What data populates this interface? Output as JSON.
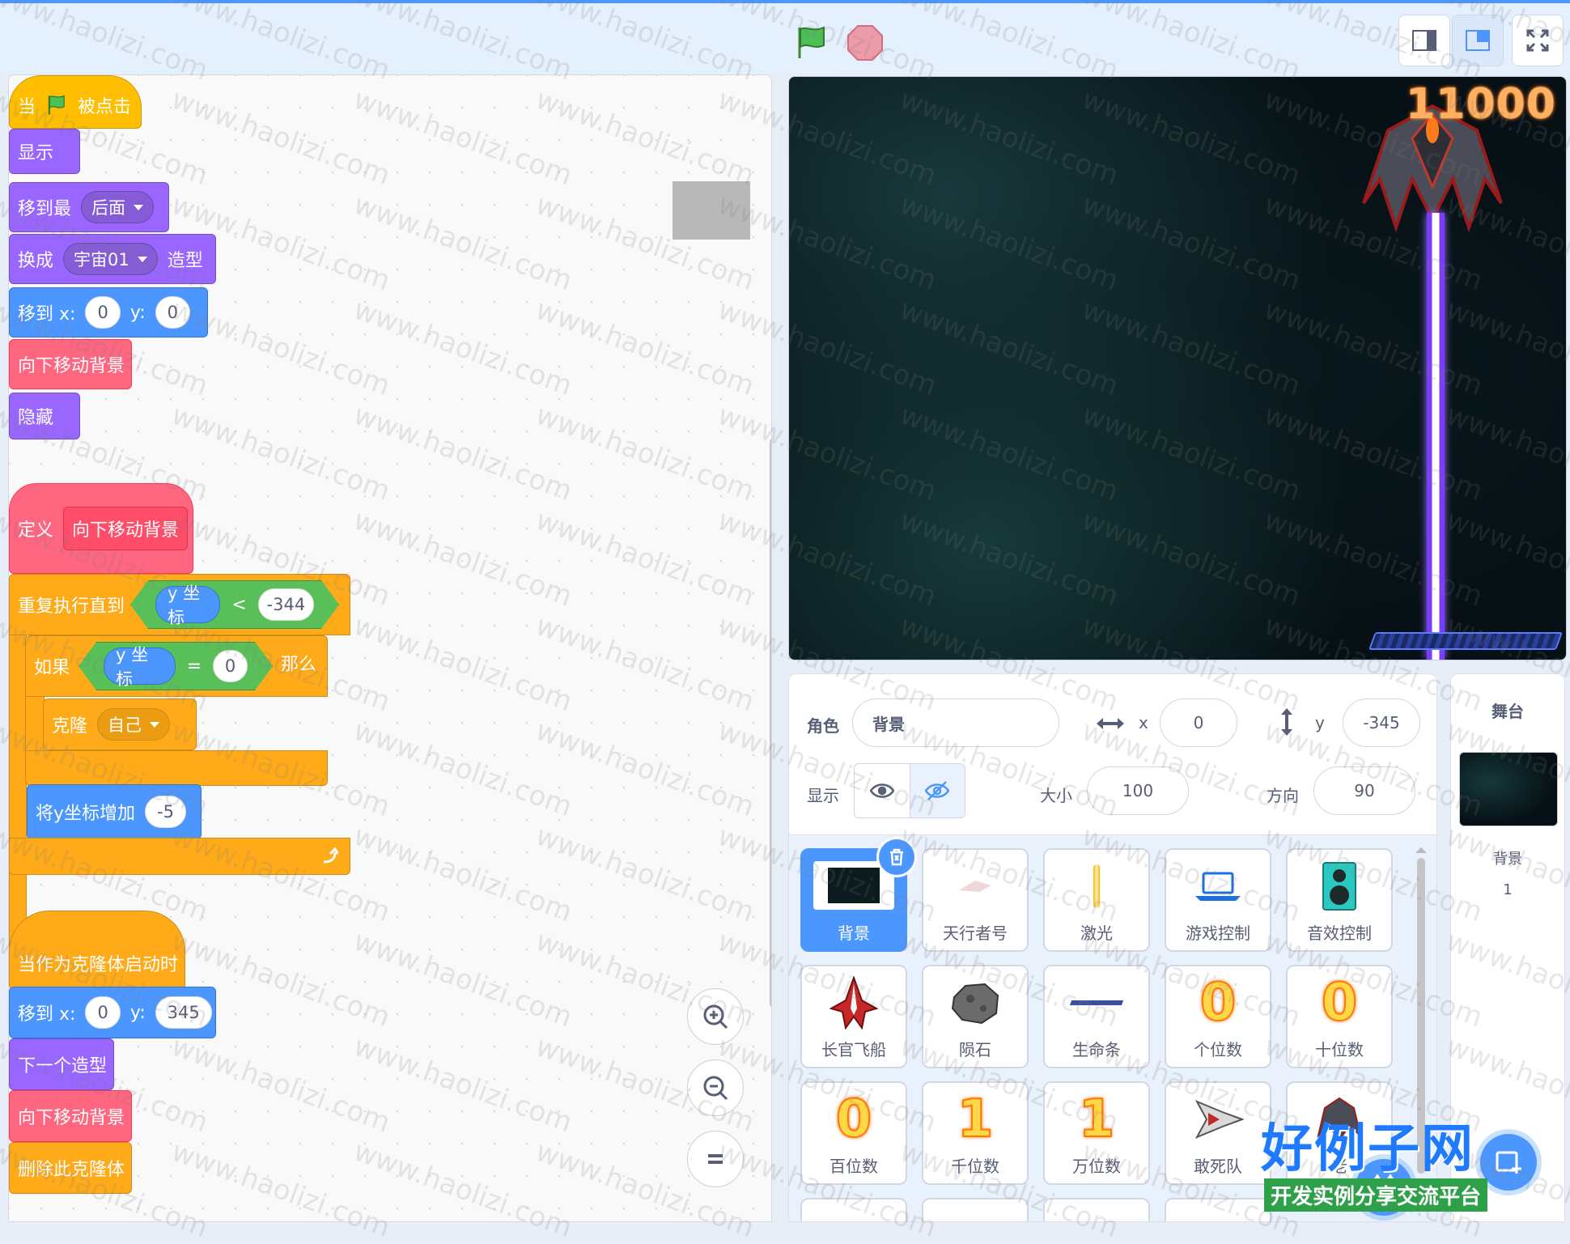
{
  "colors": {
    "accent": "#4c97ff",
    "events": "#ffbf00",
    "looks": "#9966ff",
    "motion": "#4c97ff",
    "myblocks": "#ff6680",
    "control": "#ffab19",
    "operators": "#59c059"
  },
  "toolbar": {
    "green_flag_icon": "green-flag-icon",
    "stop_icon": "stop-icon"
  },
  "scripts": {
    "s1": {
      "when": "当",
      "clicked": "被点击",
      "show": "显示",
      "goto_layer": "移到最",
      "goto_layer_opt": "后面",
      "switch_costume": "换成",
      "costume_opt": "宇宙01",
      "costume_suffix": "造型",
      "goto_xy": "移到 x:",
      "x": "0",
      "y_label": "y:",
      "y": "0",
      "call_move": "向下移动背景",
      "hide": "隐藏"
    },
    "s2": {
      "define": "定义",
      "proc_name": "向下移动背景",
      "repeat_until": "重复执行直到",
      "y_coord": "y 坐标",
      "lt": "<",
      "lt_val": "-344",
      "if": "如果",
      "y_coord2": "y 坐标",
      "eq": "=",
      "eq_val": "0",
      "then": "那么",
      "clone": "克隆",
      "clone_opt": "自己",
      "change_y": "将y坐标增加",
      "change_y_val": "-5"
    },
    "s3": {
      "clone_start": "当作为克隆体启动时",
      "goto_xy": "移到 x:",
      "x": "0",
      "y_label": "y:",
      "y": "345",
      "next_costume": "下一个造型",
      "call_move": "向下移动背景",
      "delete_clone": "删除此克隆体"
    }
  },
  "stage": {
    "score": "11000"
  },
  "sprite_info": {
    "sprite_label": "角色",
    "sprite_name": "背景",
    "x_label": "x",
    "x": "0",
    "y_label": "y",
    "y": "-345",
    "show_label": "显示",
    "size_label": "大小",
    "size": "100",
    "direction_label": "方向",
    "direction": "90"
  },
  "sprites": [
    {
      "name": "背景",
      "selected": true
    },
    {
      "name": "天行者号"
    },
    {
      "name": "激光"
    },
    {
      "name": "游戏控制"
    },
    {
      "name": "音效控制"
    },
    {
      "name": "长官飞船"
    },
    {
      "name": "陨石"
    },
    {
      "name": "生命条"
    },
    {
      "name": "个位数",
      "digit": "0"
    },
    {
      "name": "十位数",
      "digit": "0"
    },
    {
      "name": "百位数",
      "digit": "0"
    },
    {
      "name": "千位数",
      "digit": "1"
    },
    {
      "name": "万位数",
      "digit": "1"
    },
    {
      "name": "敢死队"
    },
    {
      "name": "老"
    }
  ],
  "stage_panel": {
    "title": "舞台",
    "bg_label": "背景",
    "bg_count": "1"
  },
  "watermark": {
    "logo": "好例子网",
    "tagline": "开发实例分享交流平台",
    "repeat": "www.haolizi.com"
  }
}
